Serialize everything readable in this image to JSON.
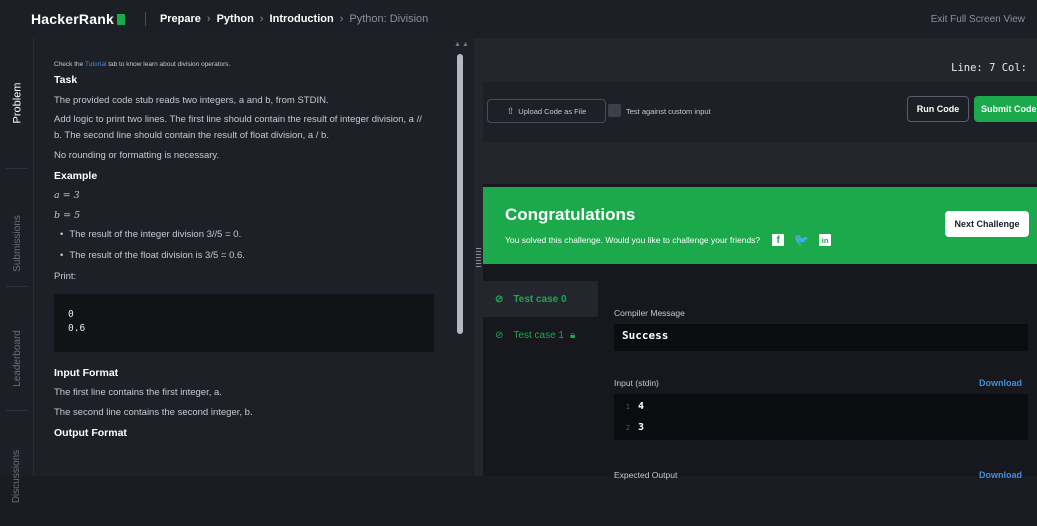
{
  "header": {
    "logo": "HackerRank",
    "breadcrumb": [
      "Prepare",
      "Python",
      "Introduction",
      "Python: Division"
    ],
    "exit_fullscreen": "Exit Full Screen View"
  },
  "left_tabs": [
    "Problem",
    "Submissions",
    "Leaderboard",
    "Discussions"
  ],
  "problem": {
    "hint_prefix": "Check the ",
    "hint_link": "Tutorial",
    "hint_suffix": " tab to know learn about division operators.",
    "task_heading": "Task",
    "task_line1": "The provided code stub reads two integers, a and b, from STDIN.",
    "task_line2": "Add logic to print two lines. The first line should contain the result of integer division, a //",
    "task_line3": "b. The second line should contain the result of float division, a / b.",
    "task_line4": "No rounding or formatting is necessary.",
    "example_heading": "Example",
    "example_a": "a = 3",
    "example_b": "b = 5",
    "bullet1": "The result of the integer division 3//5 = 0.",
    "bullet2": "The result of the float division is 3/5 = 0.6.",
    "print_label": "Print:",
    "code_lines": [
      "0",
      "0.6"
    ],
    "input_format_heading": "Input Format",
    "input_line1": "The first line contains the first integer, a.",
    "input_line2": "The second line contains the second integer, b.",
    "output_format_heading": "Output Format"
  },
  "editor": {
    "line_col": "Line: 7 Col:"
  },
  "actions": {
    "upload": "Upload Code as File",
    "custom_input": "Test against custom input",
    "run": "Run Code",
    "submit": "Submit Code"
  },
  "congrats": {
    "title": "Congratulations",
    "subtitle": "You solved this challenge. Would you like to challenge your friends?",
    "next": "Next Challenge"
  },
  "results": {
    "test_cases": [
      "Test case 0",
      "Test case 1"
    ],
    "compiler_label": "Compiler Message",
    "compiler_value": "Success",
    "input_label": "Input (stdin)",
    "download": "Download",
    "input_lines": [
      "4",
      "3"
    ],
    "expected_label": "Expected Output"
  },
  "colors": {
    "accent_green": "#1ba94c",
    "link_blue": "#3d8fe0"
  }
}
